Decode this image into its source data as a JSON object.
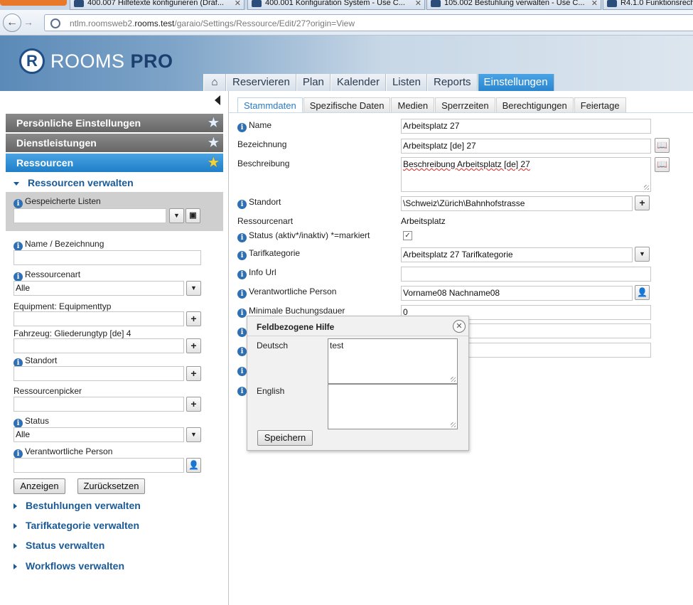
{
  "browser": {
    "tabs": [
      {
        "title": "400.007 Hilfetexte konfigurieren (Draf..."
      },
      {
        "title": "400.001 Konfiguration System - Use C..."
      },
      {
        "title": "105.002 Bestuhlung verwalten - Use C..."
      },
      {
        "title": "R4.1.0 Funktionsrech"
      }
    ],
    "url": {
      "prefix": "ntlm.roomsweb2.",
      "host": "rooms.test",
      "path": "/garaio/Settings/Ressource/Edit/27?origin=View"
    }
  },
  "app": {
    "logo_letter": "R",
    "logo_word1": "ROOMS",
    "logo_word2": "PRO",
    "nav": [
      "Reservieren",
      "Plan",
      "Kalender",
      "Listen",
      "Reports",
      "Einstellungen"
    ],
    "nav_active": "Einstellungen"
  },
  "sidebar": {
    "sections": [
      {
        "label": "Persönliche Einstellungen"
      },
      {
        "label": "Dienstleistungen"
      },
      {
        "label": "Ressourcen"
      }
    ],
    "active_sub": "Ressourcen verwalten",
    "saved_lists_label": "Gespeicherte Listen",
    "filters": {
      "name_label": "Name / Bezeichnung",
      "name_value": "",
      "resart_label": "Ressourcenart",
      "resart_value": "Alle",
      "equip_label": "Equipment: Equipmenttyp",
      "fahrzeug_label": "Fahrzeug: Gliederungtyp [de] 4",
      "standort_label": "Standort",
      "picker_label": "Ressourcenpicker",
      "status_label": "Status",
      "status_value": "Alle",
      "person_label": "Verantwortliche Person"
    },
    "show_button": "Anzeigen",
    "reset_button": "Zurücksetzen",
    "other_links": [
      "Bestuhlungen verwalten",
      "Tarifkategorie verwalten",
      "Status verwalten",
      "Workflows verwalten"
    ]
  },
  "content": {
    "tabs": [
      "Stammdaten",
      "Spezifische Daten",
      "Medien",
      "Sperrzeiten",
      "Berechtigungen",
      "Feiertage"
    ],
    "active_tab": "Stammdaten",
    "fields": {
      "name_label": "Name",
      "name_value": "Arbeitsplatz 27",
      "bez_label": "Bezeichnung",
      "bez_value": "Arbeitsplatz [de] 27",
      "beschr_label": "Beschreibung",
      "beschr_value": "Beschreibung Arbeitsplatz [de] 27",
      "standort_label": "Standort",
      "standort_value": "\\Schweiz\\Zürich\\Bahnhofstrasse",
      "resart_label": "Ressourcenart",
      "resart_value": "Arbeitsplatz",
      "status_label": "Status (aktiv*/inaktiv) *=markiert",
      "status_checked": true,
      "tarif_label": "Tarifkategorie",
      "tarif_value": "Arbeitsplatz 27 Tarifkategorie",
      "infourl_label": "Info Url",
      "infourl_value": "",
      "person_label": "Verantwortliche Person",
      "person_value": "Vorname08 Nachname08",
      "minbuch_label": "Minimale Buchungsdauer",
      "minbuch_value": "0"
    }
  },
  "help_dialog": {
    "title": "Feldbezogene Hilfe",
    "de_label": "Deutsch",
    "de_value": "test",
    "en_label": "English",
    "en_value": "",
    "save_button": "Speichern"
  },
  "icons": {
    "home": "home-icon",
    "info": "info-icon",
    "star": "star-icon",
    "book": "book-icon",
    "plus": "plus-icon",
    "person": "person-icon",
    "save": "floppy-disk-icon",
    "dropdown": "chevron-down-icon",
    "close": "close-icon"
  },
  "colors": {
    "accent_blue": "#2a86cf",
    "link_blue": "#1a5a96",
    "info_blue": "#2f6fb3",
    "sidebar_gray": "#777777"
  }
}
